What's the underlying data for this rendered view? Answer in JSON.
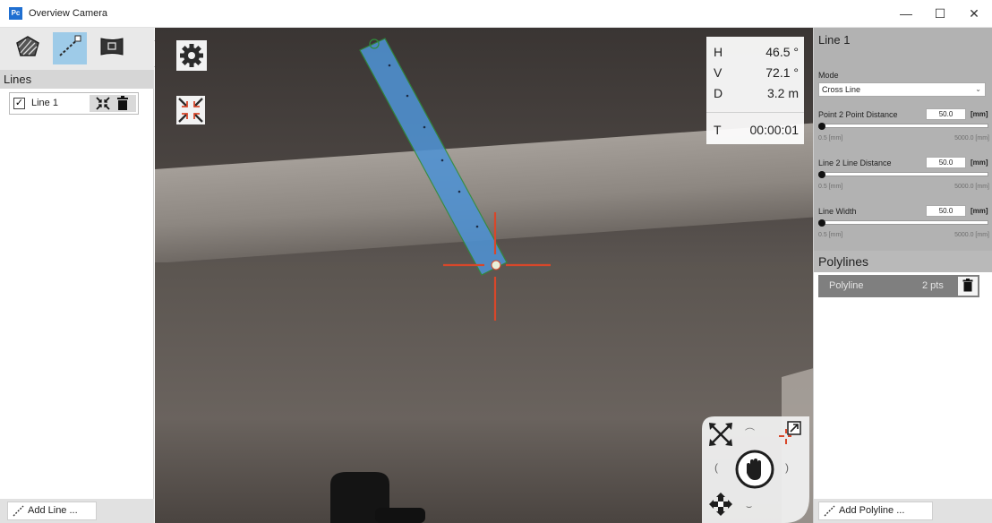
{
  "window": {
    "app_icon_text": "Pc",
    "title": "Overview Camera",
    "minimize_glyph": "—",
    "maximize_glyph": "☐",
    "close_glyph": "✕"
  },
  "left_panel": {
    "tools": [
      {
        "name": "hatch-area-tool-icon",
        "active": false
      },
      {
        "name": "line-tool-icon",
        "active": true
      },
      {
        "name": "camera-view-tool-icon",
        "active": false
      }
    ],
    "section_title": "Lines",
    "lines": [
      {
        "label": "Line 1",
        "checked": true,
        "check_glyph": "✓"
      }
    ],
    "collapse_glyph": "<",
    "add_button_label": "Add Line ..."
  },
  "viewport": {
    "readout": [
      {
        "key": "H",
        "value": "46.5 °"
      },
      {
        "key": "V",
        "value": "72.1 °"
      },
      {
        "key": "D",
        "value": "3.2 m"
      },
      {
        "key": "T",
        "value": "00:00:01"
      }
    ]
  },
  "properties": {
    "title": "Line 1",
    "mode_label": "Mode",
    "mode_value": "Cross Line",
    "sliders": [
      {
        "label": "Point 2 Point Distance",
        "value": "50.0",
        "unit": "[mm]",
        "min": "0.5 [mm]",
        "max": "5000.0 [mm]",
        "level": 0.01
      },
      {
        "label": "Line 2 Line Distance",
        "value": "50.0",
        "unit": "[mm]",
        "min": "0.5 [mm]",
        "max": "5000.0 [mm]",
        "level": 0.01
      },
      {
        "label": "Line Width",
        "value": "50.0",
        "unit": "[mm]",
        "min": "0.5 [mm]",
        "max": "5000.0 [mm]",
        "level": 0.01
      }
    ]
  },
  "polylines": {
    "title": "Polylines",
    "items": [
      {
        "label": "Polyline",
        "points": "2 pts"
      }
    ],
    "add_button_label": "Add Polyline ..."
  },
  "colors": {
    "accent_blue": "#4f92d3",
    "crosshair_red": "#d8472a",
    "active_tool": "#9ecbe8"
  }
}
